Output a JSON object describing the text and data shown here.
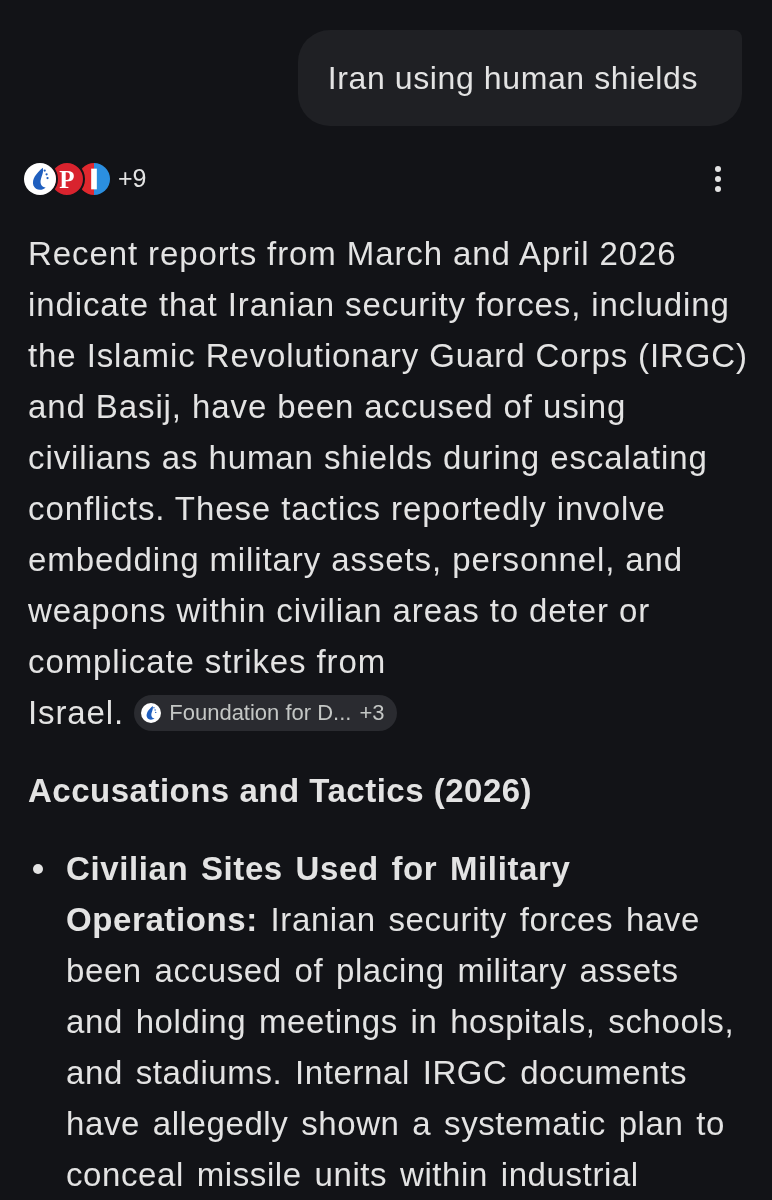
{
  "query": {
    "text": "Iran using human shields"
  },
  "sources": {
    "logos": [
      {
        "kind": "flame"
      },
      {
        "kind": "letter",
        "letter": "P"
      },
      {
        "kind": "split"
      }
    ],
    "count": "+9"
  },
  "paragraph": {
    "text": "Recent reports from March and April 2026 indicate that Iranian security forces, including the Islamic Revolutionary Guard Corps (IRGC) and Basij, have been accused of using civilians as human shields during escalating conflicts. These tactics reportedly involve embedding military assets, personnel, and weapons within civilian areas to deter or complicate strikes from Israel.",
    "citation": {
      "label": "Foundation for D...",
      "count": "+3"
    }
  },
  "heading": "Accusations and Tactics (2026)",
  "bullets": [
    {
      "text": "**Civilian Sites Used for Military Operations:** Iranian security forces have been accused of placing military assets and holding meetings in hospitals, schools, and stadiums. Internal IRGC documents have allegedly shown a systematic plan to conceal missile units within industrial"
    }
  ]
}
